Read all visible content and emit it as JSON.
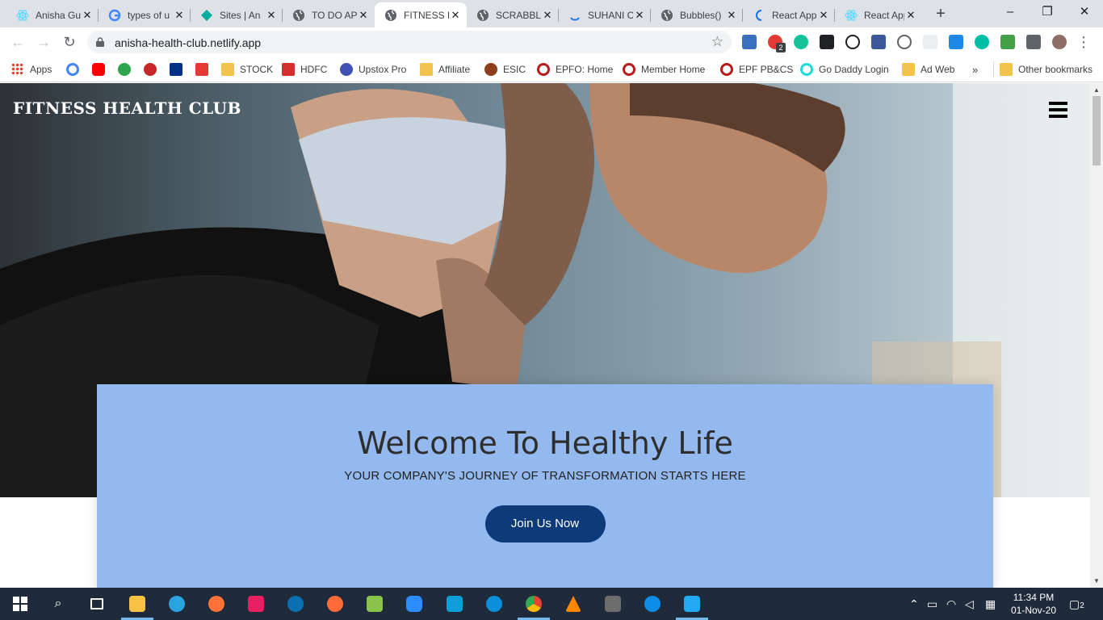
{
  "browser": {
    "tabs": [
      {
        "title": "Anisha Gu",
        "icon": "react-icon",
        "color": "#61dafb",
        "active": false
      },
      {
        "title": "types of u",
        "icon": "google-icon",
        "color": "#4285f4",
        "active": false
      },
      {
        "title": "Sites | An",
        "icon": "netlify-icon",
        "color": "#00ad9f",
        "active": false
      },
      {
        "title": "TO DO AP",
        "icon": "globe-icon",
        "color": "#5f6368",
        "active": false
      },
      {
        "title": "FITNESS H",
        "icon": "globe-icon",
        "color": "#5f6368",
        "active": true
      },
      {
        "title": "SCRABBLE",
        "icon": "globe-icon",
        "color": "#5f6368",
        "active": false
      },
      {
        "title": "SUHANI C",
        "icon": "loading-icon",
        "color": "#1a73e8",
        "active": false
      },
      {
        "title": "Bubbles()",
        "icon": "globe-icon",
        "color": "#5f6368",
        "active": false
      },
      {
        "title": "React App",
        "icon": "loading-icon",
        "color": "#1a73e8",
        "active": false
      },
      {
        "title": "React App",
        "icon": "react-icon",
        "color": "#61dafb",
        "active": false
      }
    ],
    "new_tab": "+",
    "window_controls": {
      "minimize": "–",
      "restore": "❐",
      "close": "✕"
    },
    "url": "anisha-health-club.netlify.app",
    "extension_badge": "2",
    "bookmarks": [
      {
        "label": "Apps",
        "icon": "apps-grid-icon",
        "color": "#ea4335"
      },
      {
        "label": "",
        "icon": "google-icon",
        "color": "#4285f4"
      },
      {
        "label": "",
        "icon": "youtube-icon",
        "color": "#ff0000"
      },
      {
        "label": "",
        "icon": "green-app-icon",
        "color": "#2ea44f"
      },
      {
        "label": "",
        "icon": "red-app-icon",
        "color": "#c62828"
      },
      {
        "label": "",
        "icon": "paypal-icon",
        "color": "#003087"
      },
      {
        "label": "",
        "icon": "red-arrow-icon",
        "color": "#e53935"
      },
      {
        "label": "STOCK",
        "icon": "folder-icon",
        "color": "#f2c44e"
      },
      {
        "label": "HDFC",
        "icon": "hdfc-icon",
        "color": "#d32f2f"
      },
      {
        "label": "Upstox Pro",
        "icon": "upstox-icon",
        "color": "#3f51b5"
      },
      {
        "label": "Affiliate",
        "icon": "folder-icon",
        "color": "#f2c44e"
      },
      {
        "label": "ESIC",
        "icon": "esic-icon",
        "color": "#8d3e1c"
      },
      {
        "label": "EPFO: Home",
        "icon": "epfo-icon",
        "color": "#b71c1c"
      },
      {
        "label": "Member Home",
        "icon": "epfo-icon",
        "color": "#b71c1c"
      },
      {
        "label": "EPF PB&CS",
        "icon": "epfo-icon",
        "color": "#b71c1c"
      },
      {
        "label": "Go Daddy Login",
        "icon": "godaddy-icon",
        "color": "#1bdbdb"
      },
      {
        "label": "Ad Web",
        "icon": "folder-icon",
        "color": "#f2c44e"
      }
    ],
    "bookmarks_overflow": "»",
    "other_bookmarks": "Other bookmarks"
  },
  "page": {
    "brand": "FITNESS HEALTH CLUB",
    "welcome_title": "Welcome To Healthy Life",
    "welcome_subtitle": "YOUR COMPANY'S JOURNEY OF TRANSFORMATION STARTS HERE",
    "cta_label": "Join Us Now"
  },
  "taskbar": {
    "time": "11:34 PM",
    "date": "01-Nov-20",
    "notifications": "2"
  }
}
